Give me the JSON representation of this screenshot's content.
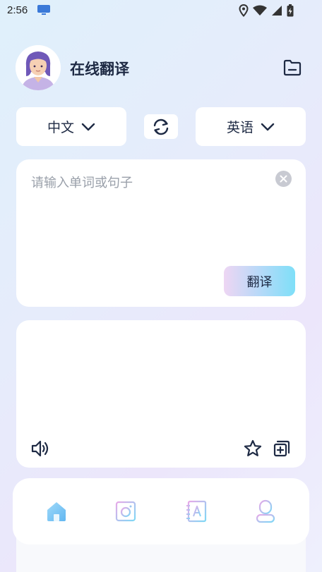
{
  "status_bar": {
    "time": "2:56"
  },
  "header": {
    "title": "在线翻译",
    "avatar_icon": "user-avatar",
    "folder_icon": "folder-icon"
  },
  "languages": {
    "source": "中文",
    "target": "英语",
    "swap_icon": "swap-icon"
  },
  "input": {
    "placeholder": "请输入单词或句子",
    "clear_icon": "clear-icon",
    "translate_label": "翻译"
  },
  "output": {
    "text": "",
    "speaker_icon": "speaker-icon",
    "favorite_icon": "star-icon",
    "copy_icon": "copy-icon"
  },
  "bottom_nav": {
    "items": [
      {
        "id": "home",
        "icon": "home-icon",
        "active": true
      },
      {
        "id": "camera",
        "icon": "camera-icon",
        "active": false
      },
      {
        "id": "dictionary",
        "icon": "dictionary-icon",
        "active": false
      },
      {
        "id": "profile",
        "icon": "profile-icon",
        "active": false
      }
    ]
  },
  "colors": {
    "accent_cyan": "#7edff8",
    "accent_pink": "#eed6f3",
    "title_text": "#1e2a44",
    "placeholder_text": "#9aa0aa"
  }
}
